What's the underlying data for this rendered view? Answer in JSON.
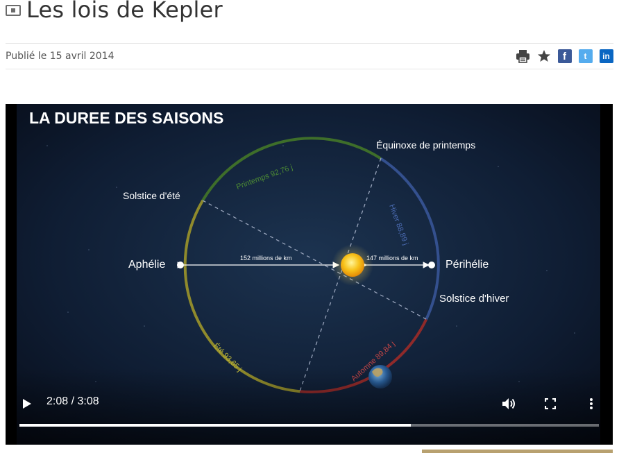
{
  "page": {
    "title": "Les lois de Kepler",
    "published": "Publié le 15 avril 2014"
  },
  "actions": [
    {
      "name": "print-icon",
      "label": ""
    },
    {
      "name": "star-icon",
      "label": ""
    },
    {
      "name": "facebook-icon",
      "label": "f"
    },
    {
      "name": "twitter-icon",
      "label": "t"
    },
    {
      "name": "linkedin-icon",
      "label": "in"
    }
  ],
  "video": {
    "heading": "LA DUREE DES SAISONS",
    "labels": {
      "equinoxe": "Équinoxe de printemps",
      "solstice_ete": "Solstice d'été",
      "aphelie": "Aphélie",
      "perihelie": "Périhélie",
      "solstice_hiver": "Solstice d'hiver",
      "dist_aphelie": "152 millions de km",
      "dist_perihelie": "147 millions de km",
      "printemps": "Printemps 92,76 j",
      "hiver": "Hiver 88,89 j",
      "ete": "Été 93,65 j",
      "automne": "Automne 89,84 j"
    },
    "colors": {
      "printemps": "#3e6e2a",
      "hiver": "#34508e",
      "ete": "#8f8a2c",
      "automne": "#8f2a2a"
    },
    "player": {
      "time": "2:08 / 3:08",
      "progress": 0.676
    }
  }
}
